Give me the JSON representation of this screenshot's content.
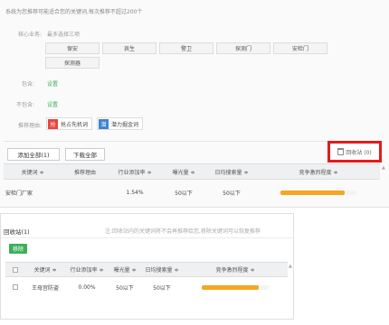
{
  "intro": "系统为您推荐可能适合您的关键词,每次推荐不超过200个",
  "core": {
    "label": "核心业务:",
    "hint": "最多选择三项",
    "keywords": [
      "保安",
      "哀生",
      "警卫",
      "探测门",
      "安检门",
      "探测器"
    ]
  },
  "include": {
    "label": "包含:",
    "action": "设置"
  },
  "exclude": {
    "label": "不包含:",
    "action": "设置"
  },
  "reason": {
    "label": "推荐理由:",
    "items": [
      {
        "badge": "抢",
        "label": "抢占先机词"
      },
      {
        "badge": "潜",
        "label": "潜力掘金词"
      }
    ]
  },
  "toolbar": {
    "add_all": "添加全部(1)",
    "download_all": "下载全部",
    "recycle": "回收站 (0)"
  },
  "main_table": {
    "headers": [
      "关键词 ≑",
      "推荐理由",
      "行业添加率 ≑",
      "曝光量 ≑",
      "日均搜索量 ≑",
      "竞争激烈程度 ≑"
    ],
    "rows": [
      {
        "keyword": "安检门厂家",
        "reason": "",
        "add_rate": "1.54%",
        "exposure": "50以下",
        "daily_search": "50以下",
        "competition": 0.85
      }
    ]
  },
  "recycle_panel": {
    "title": "回收站(1)",
    "note": "注:回收站内的关键词将不会再推荐给您,移除关键词可以恢复推荐",
    "remove_label": "移除",
    "headers": [
      "关键词 ≑",
      "行业添加率 ≑",
      "曝光量 ≑",
      "日均搜索量 ≑",
      "竞争激烈程度 ≑"
    ],
    "rows": [
      {
        "keyword": "王母宫防盗",
        "add_rate": "0.00%",
        "exposure": "50以下",
        "daily_search": "50以下",
        "competition": 0.85
      }
    ]
  },
  "colors": {
    "accent_green": "#3cae5b",
    "highlight_red": "#e8191a",
    "bar_orange": "#f5a623"
  }
}
